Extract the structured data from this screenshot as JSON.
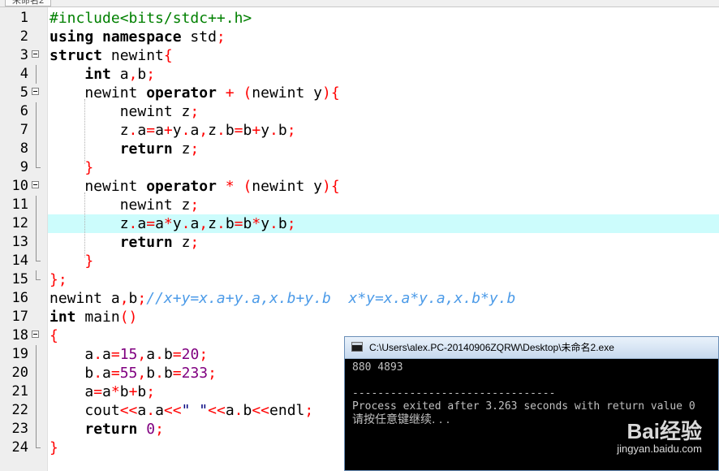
{
  "editor": {
    "tab_label": "未命名2",
    "highlighted_line": 12,
    "lines": [
      {
        "n": "1",
        "segs": [
          {
            "t": "#include<bits/stdc++.h>",
            "c": "pp"
          }
        ]
      },
      {
        "n": "2",
        "segs": [
          {
            "t": "using namespace ",
            "c": "kw"
          },
          {
            "t": "std",
            "c": ""
          },
          {
            "t": ";",
            "c": "sy"
          }
        ]
      },
      {
        "n": "3",
        "fold": "start",
        "segs": [
          {
            "t": "struct ",
            "c": "kw"
          },
          {
            "t": "newint",
            "c": ""
          },
          {
            "t": "{",
            "c": "sy"
          }
        ]
      },
      {
        "n": "4",
        "fold": "line",
        "segs": [
          {
            "t": "    ",
            "c": ""
          },
          {
            "t": "int ",
            "c": "kw"
          },
          {
            "t": "a",
            "c": ""
          },
          {
            "t": ",",
            "c": "sy"
          },
          {
            "t": "b",
            "c": ""
          },
          {
            "t": ";",
            "c": "sy"
          }
        ]
      },
      {
        "n": "5",
        "fold": "start",
        "segs": [
          {
            "t": "    newint ",
            "c": ""
          },
          {
            "t": "operator ",
            "c": "kw"
          },
          {
            "t": "+ (",
            "c": "sy"
          },
          {
            "t": "newint y",
            "c": ""
          },
          {
            "t": "){",
            "c": "sy"
          }
        ]
      },
      {
        "n": "6",
        "fold": "line",
        "segs": [
          {
            "t": "        newint z",
            "c": ""
          },
          {
            "t": ";",
            "c": "sy"
          }
        ]
      },
      {
        "n": "7",
        "fold": "line",
        "segs": [
          {
            "t": "        z",
            "c": ""
          },
          {
            "t": ".",
            "c": "sy"
          },
          {
            "t": "a",
            "c": ""
          },
          {
            "t": "=",
            "c": "sy"
          },
          {
            "t": "a",
            "c": ""
          },
          {
            "t": "+",
            "c": "sy"
          },
          {
            "t": "y",
            "c": ""
          },
          {
            "t": ".",
            "c": "sy"
          },
          {
            "t": "a",
            "c": ""
          },
          {
            "t": ",",
            "c": "sy"
          },
          {
            "t": "z",
            "c": ""
          },
          {
            "t": ".",
            "c": "sy"
          },
          {
            "t": "b",
            "c": ""
          },
          {
            "t": "=",
            "c": "sy"
          },
          {
            "t": "b",
            "c": ""
          },
          {
            "t": "+",
            "c": "sy"
          },
          {
            "t": "y",
            "c": ""
          },
          {
            "t": ".",
            "c": "sy"
          },
          {
            "t": "b",
            "c": ""
          },
          {
            "t": ";",
            "c": "sy"
          }
        ]
      },
      {
        "n": "8",
        "fold": "line",
        "segs": [
          {
            "t": "        ",
            "c": ""
          },
          {
            "t": "return ",
            "c": "kw"
          },
          {
            "t": "z",
            "c": ""
          },
          {
            "t": ";",
            "c": "sy"
          }
        ]
      },
      {
        "n": "9",
        "fold": "end",
        "segs": [
          {
            "t": "    ",
            "c": ""
          },
          {
            "t": "}",
            "c": "sy"
          }
        ]
      },
      {
        "n": "10",
        "fold": "start",
        "segs": [
          {
            "t": "    newint ",
            "c": ""
          },
          {
            "t": "operator ",
            "c": "kw"
          },
          {
            "t": "* (",
            "c": "sy"
          },
          {
            "t": "newint y",
            "c": ""
          },
          {
            "t": "){",
            "c": "sy"
          }
        ]
      },
      {
        "n": "11",
        "fold": "line",
        "segs": [
          {
            "t": "        newint z",
            "c": ""
          },
          {
            "t": ";",
            "c": "sy"
          }
        ]
      },
      {
        "n": "12",
        "fold": "line",
        "segs": [
          {
            "t": "        z",
            "c": ""
          },
          {
            "t": ".",
            "c": "sy"
          },
          {
            "t": "a",
            "c": ""
          },
          {
            "t": "=",
            "c": "sy"
          },
          {
            "t": "a",
            "c": ""
          },
          {
            "t": "*",
            "c": "sy"
          },
          {
            "t": "y",
            "c": ""
          },
          {
            "t": ".",
            "c": "sy"
          },
          {
            "t": "a",
            "c": ""
          },
          {
            "t": ",",
            "c": "sy"
          },
          {
            "t": "z",
            "c": ""
          },
          {
            "t": ".",
            "c": "sy"
          },
          {
            "t": "b",
            "c": ""
          },
          {
            "t": "=",
            "c": "sy"
          },
          {
            "t": "b",
            "c": ""
          },
          {
            "t": "*",
            "c": "sy"
          },
          {
            "t": "y",
            "c": ""
          },
          {
            "t": ".",
            "c": "sy"
          },
          {
            "t": "b",
            "c": ""
          },
          {
            "t": ";",
            "c": "sy"
          }
        ]
      },
      {
        "n": "13",
        "fold": "line",
        "segs": [
          {
            "t": "        ",
            "c": ""
          },
          {
            "t": "return ",
            "c": "kw"
          },
          {
            "t": "z",
            "c": ""
          },
          {
            "t": ";",
            "c": "sy"
          }
        ]
      },
      {
        "n": "14",
        "fold": "end",
        "segs": [
          {
            "t": "    ",
            "c": ""
          },
          {
            "t": "}",
            "c": "sy"
          }
        ]
      },
      {
        "n": "15",
        "fold": "end",
        "segs": [
          {
            "t": "};",
            "c": "sy"
          }
        ]
      },
      {
        "n": "16",
        "segs": [
          {
            "t": "newint a",
            "c": ""
          },
          {
            "t": ",",
            "c": "sy"
          },
          {
            "t": "b",
            "c": ""
          },
          {
            "t": ";",
            "c": "sy"
          },
          {
            "t": "//x+y=x.a+y.a,x.b+y.b  x*y=x.a*y.a,x.b*y.b",
            "c": "cm"
          }
        ]
      },
      {
        "n": "17",
        "segs": [
          {
            "t": "int ",
            "c": "kw"
          },
          {
            "t": "main",
            "c": ""
          },
          {
            "t": "()",
            "c": "sy"
          }
        ]
      },
      {
        "n": "18",
        "fold": "start",
        "segs": [
          {
            "t": "{",
            "c": "sy"
          }
        ]
      },
      {
        "n": "19",
        "fold": "line",
        "segs": [
          {
            "t": "    a",
            "c": ""
          },
          {
            "t": ".",
            "c": "sy"
          },
          {
            "t": "a",
            "c": ""
          },
          {
            "t": "=",
            "c": "sy"
          },
          {
            "t": "15",
            "c": "nm"
          },
          {
            "t": ",",
            "c": "sy"
          },
          {
            "t": "a",
            "c": ""
          },
          {
            "t": ".",
            "c": "sy"
          },
          {
            "t": "b",
            "c": ""
          },
          {
            "t": "=",
            "c": "sy"
          },
          {
            "t": "20",
            "c": "nm"
          },
          {
            "t": ";",
            "c": "sy"
          }
        ]
      },
      {
        "n": "20",
        "fold": "line",
        "segs": [
          {
            "t": "    b",
            "c": ""
          },
          {
            "t": ".",
            "c": "sy"
          },
          {
            "t": "a",
            "c": ""
          },
          {
            "t": "=",
            "c": "sy"
          },
          {
            "t": "55",
            "c": "nm"
          },
          {
            "t": ",",
            "c": "sy"
          },
          {
            "t": "b",
            "c": ""
          },
          {
            "t": ".",
            "c": "sy"
          },
          {
            "t": "b",
            "c": ""
          },
          {
            "t": "=",
            "c": "sy"
          },
          {
            "t": "233",
            "c": "nm"
          },
          {
            "t": ";",
            "c": "sy"
          }
        ]
      },
      {
        "n": "21",
        "fold": "line",
        "segs": [
          {
            "t": "    a",
            "c": ""
          },
          {
            "t": "=",
            "c": "sy"
          },
          {
            "t": "a",
            "c": ""
          },
          {
            "t": "*",
            "c": "sy"
          },
          {
            "t": "b",
            "c": ""
          },
          {
            "t": "+",
            "c": "sy"
          },
          {
            "t": "b",
            "c": ""
          },
          {
            "t": ";",
            "c": "sy"
          }
        ]
      },
      {
        "n": "22",
        "fold": "line",
        "segs": [
          {
            "t": "    cout",
            "c": ""
          },
          {
            "t": "<<",
            "c": "sy"
          },
          {
            "t": "a",
            "c": ""
          },
          {
            "t": ".",
            "c": "sy"
          },
          {
            "t": "a",
            "c": ""
          },
          {
            "t": "<<",
            "c": "sy"
          },
          {
            "t": "\" \"",
            "c": "st"
          },
          {
            "t": "<<",
            "c": "sy"
          },
          {
            "t": "a",
            "c": ""
          },
          {
            "t": ".",
            "c": "sy"
          },
          {
            "t": "b",
            "c": ""
          },
          {
            "t": "<<",
            "c": "sy"
          },
          {
            "t": "endl",
            "c": ""
          },
          {
            "t": ";",
            "c": "sy"
          }
        ]
      },
      {
        "n": "23",
        "fold": "line",
        "segs": [
          {
            "t": "    ",
            "c": ""
          },
          {
            "t": "return ",
            "c": "kw"
          },
          {
            "t": "0",
            "c": "nm"
          },
          {
            "t": ";",
            "c": "sy"
          }
        ]
      },
      {
        "n": "24",
        "fold": "end",
        "segs": [
          {
            "t": "}",
            "c": "sy"
          }
        ]
      }
    ]
  },
  "console": {
    "title": "C:\\Users\\alex.PC-20140906ZQRW\\Desktop\\未命名2.exe",
    "output": "880 4893",
    "separator": "--------------------------------",
    "exit_message": "Process exited after 3.263 seconds with return value 0",
    "prompt": "请按任意键继续. . ."
  },
  "watermark": {
    "brand": "Bai经验",
    "url": "jingyan.baidu.com"
  }
}
